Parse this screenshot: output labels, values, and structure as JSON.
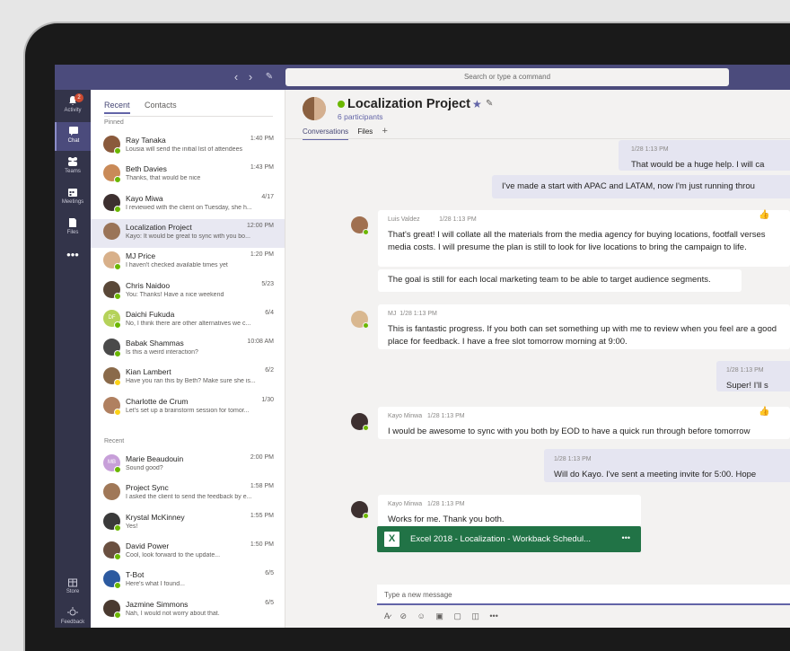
{
  "topbar": {
    "search_placeholder": "Search or type a command"
  },
  "rail": [
    {
      "label": "Activity",
      "badge": "2"
    },
    {
      "label": "Chat"
    },
    {
      "label": "Teams"
    },
    {
      "label": "Meetings"
    },
    {
      "label": "Files"
    },
    {
      "label": "Store"
    },
    {
      "label": "Feedback"
    }
  ],
  "list": {
    "tabs": [
      "Recent",
      "Contacts"
    ],
    "pinned_label": "Pinned",
    "recent_label": "Recent",
    "pinned": [
      {
        "name": "Ray Tanaka",
        "time": "1:40 PM",
        "preview": "Lousia will send the initial list of attendees",
        "color": "#8a5a3c",
        "status": "#6bb700"
      },
      {
        "name": "Beth Davies",
        "time": "1:43 PM",
        "preview": "Thanks, that would be nice",
        "color": "#c98a58",
        "status": "#6bb700"
      },
      {
        "name": "Kayo Miwa",
        "time": "4/17",
        "preview": "I reviewed with the client on Tuesday, she h...",
        "color": "#3d3030",
        "status": "#6bb700"
      },
      {
        "name": "Localization Project",
        "time": "12:00 PM",
        "preview": "Kayo: It would be great to sync with you bo...",
        "color": "#9a7458",
        "status": ""
      },
      {
        "name": "MJ Price",
        "time": "1:20 PM",
        "preview": "I haven't checked available times yet",
        "color": "#d8b08a",
        "status": "#6bb700"
      },
      {
        "name": "Chris Naidoo",
        "time": "5/23",
        "preview": "You: Thanks! Have a nice weekend",
        "color": "#5a4838",
        "status": "#6bb700"
      },
      {
        "name": "Daichi Fukuda",
        "time": "6/4",
        "preview": "No, I think there are other alternatives we c...",
        "color": "#b5d25a",
        "initials": "DF",
        "status": "#6bb700"
      },
      {
        "name": "Babak Shammas",
        "time": "10:08 AM",
        "preview": "Is this a weird interaction?",
        "color": "#4a4a4a",
        "status": "#6bb700"
      },
      {
        "name": "Kian Lambert",
        "time": "6/2",
        "preview": "Have you ran this by Beth? Make sure she is...",
        "color": "#8a6a4a",
        "status": "#fcd116"
      },
      {
        "name": "Charlotte de Crum",
        "time": "1/30",
        "preview": "Let's set up a brainstorm session for tomor...",
        "color": "#b08060",
        "status": "#fcd116"
      }
    ],
    "recent": [
      {
        "name": "Marie Beaudouin",
        "time": "2:00 PM",
        "preview": "Sound good?",
        "color": "#c79fd9",
        "initials": "MB",
        "status": "#6bb700"
      },
      {
        "name": "Project Sync",
        "time": "1:58 PM",
        "preview": "I asked the client to send the feedback by e...",
        "color": "#a07858",
        "status": ""
      },
      {
        "name": "Krystal McKinney",
        "time": "1:55 PM",
        "preview": "Yes!",
        "color": "#3a3a3a",
        "status": "#6bb700"
      },
      {
        "name": "David Power",
        "time": "1:50 PM",
        "preview": "Cool, look forward to the update...",
        "color": "#6a5040",
        "status": "#6bb700"
      },
      {
        "name": "T-Bot",
        "time": "6/5",
        "preview": "Here's what I found...",
        "color": "#2c5aa0",
        "status": "#6bb700"
      },
      {
        "name": "Jazmine Simmons",
        "time": "6/5",
        "preview": "Nah, I would not worry about that.",
        "color": "#4a3a30",
        "status": "#6bb700"
      }
    ]
  },
  "channel": {
    "title": "Localization Project",
    "participants": "6 participants",
    "tabs": [
      "Conversations",
      "Files"
    ],
    "add_tab": "+"
  },
  "messages": [
    {
      "meta": "1/28 1:13 PM",
      "text": "That would be a huge help. I will ca"
    },
    {
      "text": "I've made a start with APAC and LATAM, now I'm just running throu"
    },
    {
      "author": "Luis Valdez",
      "time": "1/28 1:13 PM",
      "text": "That's great! I will collate all the materials from the media agency for buying locations, footfall verses media costs. I will presume the plan is still to look for live locations to bring the campaign to life."
    },
    {
      "text": "The goal is still for each local marketing team to be able to target audience segments."
    },
    {
      "author": "MJ",
      "time": "1/28 1:13 PM",
      "text": "This is fantastic progress. If you both can set something up with me to review when you feel are a good place for feedback. I have a free slot tomorrow morning at 9:00."
    },
    {
      "meta": "1/28 1:13 PM",
      "text": "Super! I'll s"
    },
    {
      "author": "Kayo Minwa",
      "time": "1/28 1:13 PM",
      "text": "I would be awesome to sync with you both by EOD to have a quick run through before tomorrow"
    },
    {
      "meta": "1/28 1:13 PM",
      "text": "Will do Kayo. I've sent a meeting invite for 5:00. Hope"
    },
    {
      "author": "Kayo Minwa",
      "time": "1/28 1:13 PM",
      "text": "Works for me. Thank you both."
    }
  ],
  "file": {
    "name": "Excel 2018 - Localization - Workback Schedul...",
    "more": "•••"
  },
  "compose": {
    "placeholder": "Type a new message"
  }
}
